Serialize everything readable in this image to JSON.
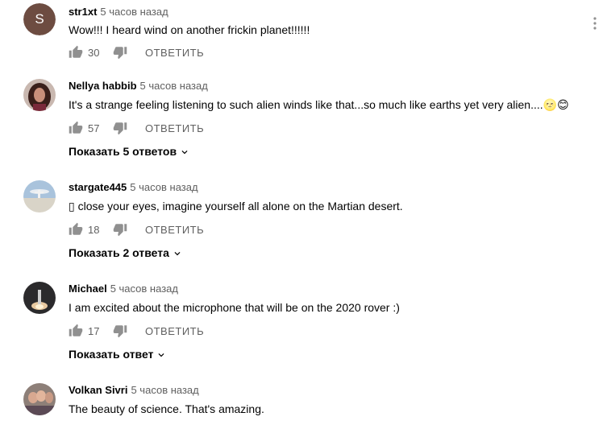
{
  "comments": [
    {
      "author": "str1xt",
      "avatar_letter": "S",
      "time": "5 часов назад",
      "text": "Wow!!! I heard wind on another frickin  planet!!!!!!",
      "likes": "30",
      "reply": "ОТВЕТИТЬ"
    },
    {
      "author": "Nellya habbib",
      "time": "5 часов назад",
      "text": "It's a strange feeling listening to such alien winds like that...so much like earths yet very alien....🌝😊",
      "likes": "57",
      "reply": "ОТВЕТИТЬ",
      "replies": "Показать 5 ответов"
    },
    {
      "author": "stargate445",
      "time": "5 часов назад",
      "text": "▯ close your eyes, imagine yourself all alone on the Martian desert.",
      "likes": "18",
      "reply": "ОТВЕТИТЬ",
      "replies": "Показать 2 ответа"
    },
    {
      "author": "Michael",
      "time": "5 часов назад",
      "text": "I am excited about the microphone that will be on the 2020 rover :)",
      "likes": "17",
      "reply": "ОТВЕТИТЬ",
      "replies": "Показать ответ"
    },
    {
      "author": "Volkan Sivri",
      "time": "5 часов назад",
      "text": "The beauty of science. That's amazing."
    }
  ]
}
